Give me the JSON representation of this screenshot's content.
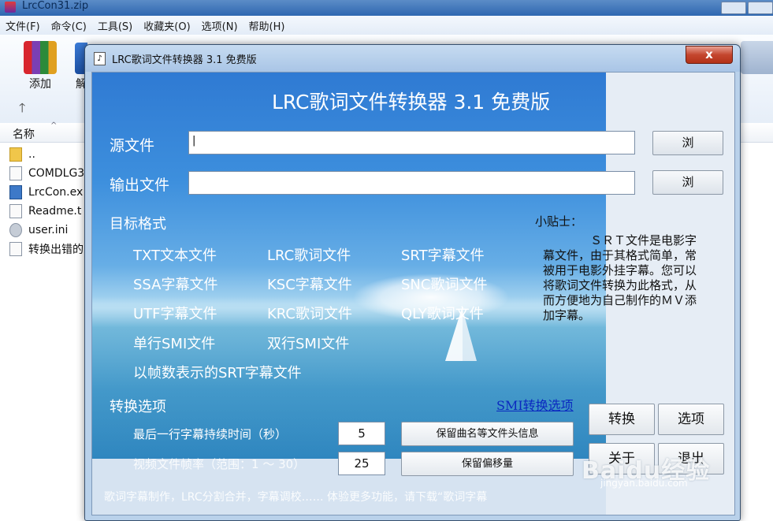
{
  "background_window": {
    "title": "LrcCon31.zip",
    "menu": [
      "文件(F)",
      "命令(C)",
      "工具(S)",
      "收藏夹(O)",
      "选项(N)",
      "帮助(H)"
    ],
    "toolbar": {
      "add": "添加",
      "extract": "解"
    },
    "column_header": "名称",
    "files": [
      "..",
      "COMDLG3",
      "LrcCon.ex",
      "Readme.t",
      "user.ini",
      "转换出错的"
    ]
  },
  "dialog": {
    "title": "LRC歌词文件转换器 3.1 免费版",
    "close_label": "x",
    "heading": "LRC歌词文件转换器 3.1 免费版",
    "source_label": "源文件",
    "output_label": "输出文件",
    "browse_label": "浏",
    "target_format_label": "目标格式",
    "formats": [
      "TXT文本文件",
      "LRC歌词文件",
      "SRT字幕文件",
      "SSA字幕文件",
      "KSC字幕文件",
      "SNC歌词文件",
      "UTF字幕文件",
      "KRC歌词文件",
      "QLY歌词文件",
      "单行SMI文件",
      "双行SMI文件",
      "以帧数表示的SRT字幕文件"
    ],
    "tip_title": "小贴士：",
    "tip_body": "ＳＲＴ文件是电影字幕文件，由于其格式简单，常被用于电影外挂字幕。您可以将歌词文件转换为此格式，从而方便地为自己制作的ＭＶ添加字幕。",
    "options_label": "转换选项",
    "smi_link": "SMI转换选项",
    "last_subtitle_label": "最后一行字幕持续时间（秒）",
    "duration_value": "5",
    "framerate_label": "视频文件帧率（范围：1 ～ 30）",
    "framerate_value": "25",
    "keep_header_label": "保留曲名等文件头信息",
    "keep_offset_label": "保留偏移量",
    "convert_label": "转换",
    "options_button_label": "选项",
    "about_label": "关于",
    "exit_label": "退出",
    "footer_text": "歌词字幕制作，LRC分割合并，字幕调校…… 体验更多功能，请下载“歌词字幕"
  },
  "watermark": {
    "brand": "Baidu经验",
    "url": "jingyan.baidu.com"
  }
}
